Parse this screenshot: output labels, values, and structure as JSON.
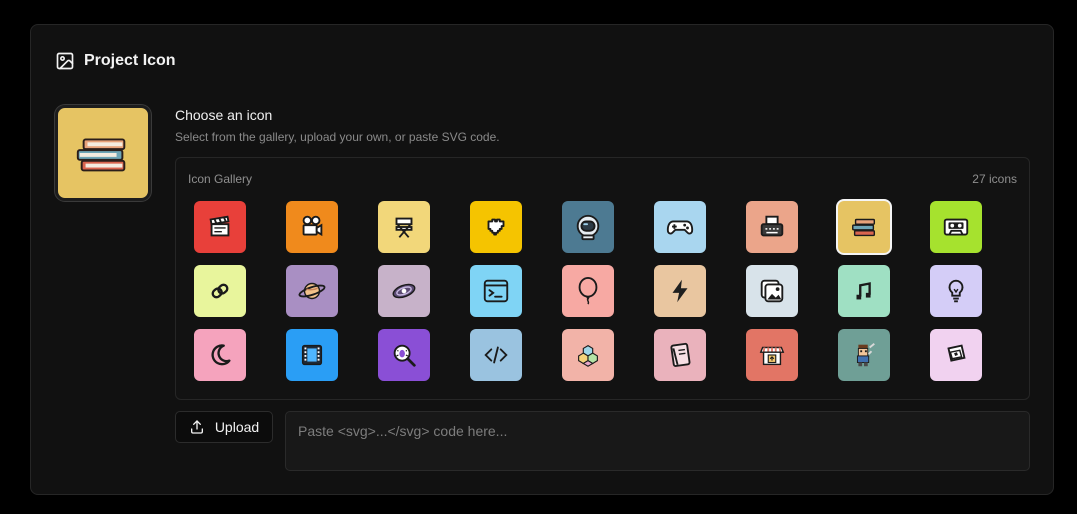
{
  "card": {
    "title": "Project Icon",
    "header_icon": "image-icon"
  },
  "chooser": {
    "title": "Choose an icon",
    "subtitle": "Select from the gallery, upload your own, or paste SVG code."
  },
  "gallery": {
    "label": "Icon Gallery",
    "count_label": "27 icons",
    "selected_index": 7,
    "icons": [
      {
        "name": "clapperboard-icon",
        "bg": "#e8403a"
      },
      {
        "name": "film-camera-icon",
        "bg": "#f08a1c"
      },
      {
        "name": "directors-chair-icon",
        "bg": "#f2d77a"
      },
      {
        "name": "pixel-heart-icon",
        "bg": "#f5c400"
      },
      {
        "name": "astronaut-helmet-icon",
        "bg": "#4d7a92"
      },
      {
        "name": "game-controller-icon",
        "bg": "#a9d6ef"
      },
      {
        "name": "typewriter-icon",
        "bg": "#eba58a"
      },
      {
        "name": "books-icon",
        "bg": "#e6c463"
      },
      {
        "name": "cassette-icon",
        "bg": "#a6e22e"
      },
      {
        "name": "chain-link-icon",
        "bg": "#e8f59c"
      },
      {
        "name": "planet-icon",
        "bg": "#a98fc3"
      },
      {
        "name": "galaxy-icon",
        "bg": "#c7b2c9"
      },
      {
        "name": "terminal-icon",
        "bg": "#7fd4f5"
      },
      {
        "name": "balloon-icon",
        "bg": "#f7a9a3"
      },
      {
        "name": "lightning-icon",
        "bg": "#e9c6a0"
      },
      {
        "name": "photos-icon",
        "bg": "#d8e3ea"
      },
      {
        "name": "music-note-icon",
        "bg": "#9fe0c3"
      },
      {
        "name": "lightbulb-icon",
        "bg": "#d4cdf7"
      },
      {
        "name": "moon-icon",
        "bg": "#f5a3bd"
      },
      {
        "name": "film-reel-icon",
        "bg": "#2a9ef5"
      },
      {
        "name": "bug-search-icon",
        "bg": "#8a4fd6"
      },
      {
        "name": "code-icon",
        "bg": "#9ac3e0"
      },
      {
        "name": "cubes-icon",
        "bg": "#f2b3a8"
      },
      {
        "name": "notebook-icon",
        "bg": "#eab2bc"
      },
      {
        "name": "shop-icon",
        "bg": "#e27565"
      },
      {
        "name": "pixel-knight-icon",
        "bg": "#6f9f96"
      },
      {
        "name": "keycap-icon",
        "bg": "#f1d2f0"
      }
    ]
  },
  "upload": {
    "label": "Upload",
    "icon": "upload-icon"
  },
  "svg_input": {
    "placeholder": "Paste <svg>...</svg> code here...",
    "value": ""
  }
}
